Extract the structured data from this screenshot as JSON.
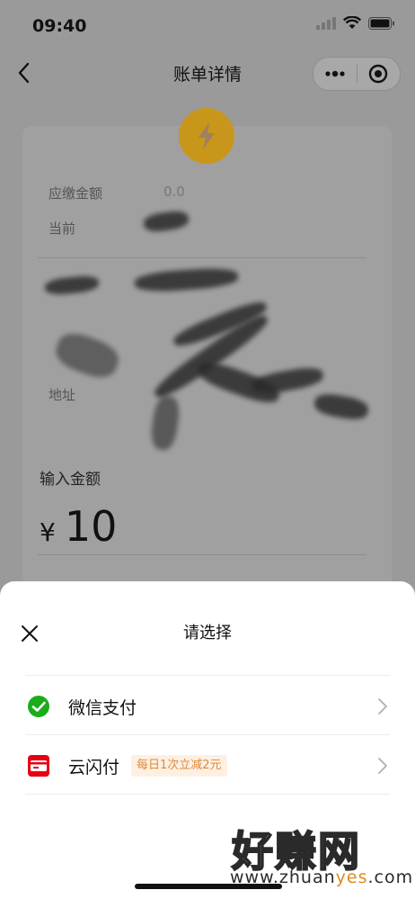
{
  "status_bar": {
    "time": "09:40"
  },
  "nav": {
    "title": "账单详情"
  },
  "bill": {
    "due_label": "应缴金额",
    "due_value": "0.0",
    "balance_label": "当前",
    "address_label": "地址"
  },
  "amount": {
    "label": "输入金额",
    "currency": "¥",
    "value": "10"
  },
  "sheet": {
    "title": "请选择",
    "options": [
      {
        "label": "微信支付",
        "icon": "wechat-pay-icon",
        "color": "#1aad19"
      },
      {
        "label": "云闪付",
        "icon": "unionpay-quickpass-icon",
        "color": "#e60012",
        "promo": "每日1次立减2元"
      }
    ]
  },
  "watermark": {
    "brand": "好赚网",
    "url_pre": "www.zhuan",
    "url_hl": "yes",
    "url_post": ".com"
  },
  "colors": {
    "accent_bolt": "#f0b21c",
    "promo_text": "#e08a3a",
    "promo_bg": "#fdf0e3"
  }
}
